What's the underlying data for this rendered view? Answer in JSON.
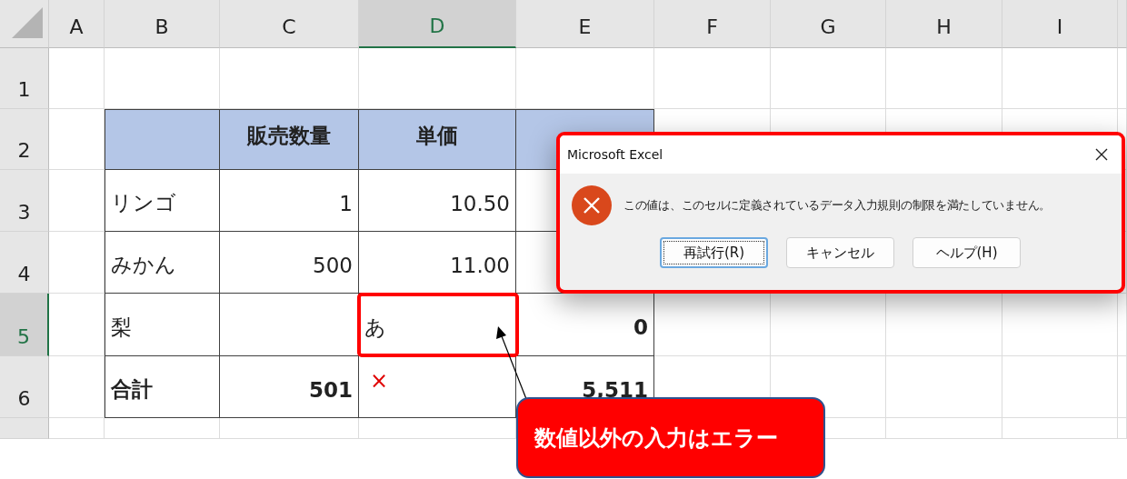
{
  "columns": [
    {
      "label": "A",
      "selected": false
    },
    {
      "label": "B",
      "selected": false
    },
    {
      "label": "C",
      "selected": false
    },
    {
      "label": "D",
      "selected": true
    },
    {
      "label": "E",
      "selected": false
    },
    {
      "label": "F",
      "selected": false
    },
    {
      "label": "G",
      "selected": false
    },
    {
      "label": "H",
      "selected": false
    },
    {
      "label": "I",
      "selected": false
    }
  ],
  "rows": [
    {
      "label": "1",
      "selected": false
    },
    {
      "label": "2",
      "selected": false
    },
    {
      "label": "3",
      "selected": false
    },
    {
      "label": "4",
      "selected": false
    },
    {
      "label": "5",
      "selected": true
    },
    {
      "label": "6",
      "selected": false
    },
    {
      "selected": false
    }
  ],
  "table": {
    "header": [
      "販売数量",
      "単価"
    ],
    "rows": [
      {
        "label": "リンゴ",
        "total": false,
        "cells": [
          {
            "kind": "number",
            "text": "1"
          },
          {
            "kind": "number",
            "text": "10.50"
          },
          {
            "kind": "hidden"
          }
        ]
      },
      {
        "label": "みかん",
        "total": false,
        "cells": [
          {
            "kind": "number",
            "text": "500"
          },
          {
            "kind": "number",
            "text": "11.00"
          },
          {
            "kind": "hidden"
          }
        ]
      },
      {
        "label": "梨",
        "total": false,
        "cells": [
          {
            "kind": "empty"
          },
          {
            "kind": "text",
            "text": "あ"
          },
          {
            "kind": "sum",
            "text": "0"
          }
        ]
      },
      {
        "label": "合計",
        "total": true,
        "cells": [
          {
            "kind": "number",
            "text": "501"
          },
          {
            "kind": "mark",
            "text": "×"
          },
          {
            "kind": "number",
            "text": "5,511"
          }
        ]
      }
    ]
  },
  "dialog": {
    "title": "Microsoft Excel",
    "message": "この値は、このセルに定義されているデータ入力規則の制限を満たしていません。",
    "buttons": [
      {
        "label": "再試行(R)",
        "focused": true
      },
      {
        "label": "キャンセル",
        "focused": false
      },
      {
        "label": "ヘルプ(H)",
        "focused": false
      }
    ]
  },
  "callout": {
    "text": "数値以外の入力はエラー"
  }
}
